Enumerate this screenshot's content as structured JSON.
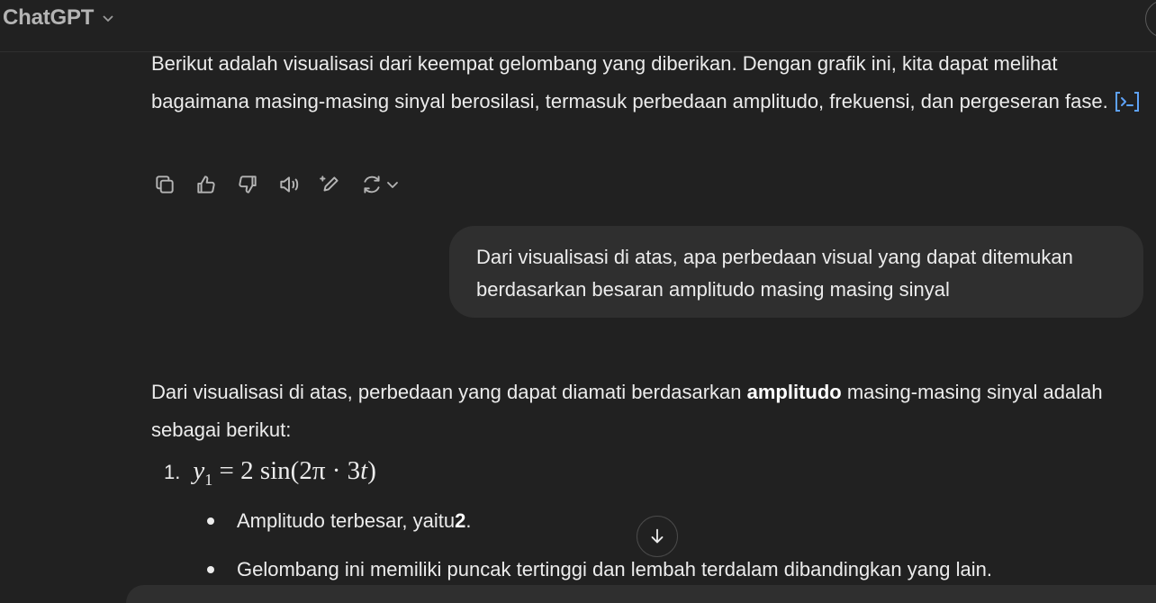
{
  "header": {
    "app_name": "ChatGPT"
  },
  "messages": {
    "assistant_intro": {
      "text": "Berikut adalah visualisasi dari keempat gelombang yang diberikan. Dengan grafik ini, kita dapat melihat bagaimana masing-masing sinyal berosilasi, termasuk perbedaan amplitudo, frekuensi, dan pergeseran fase."
    },
    "user_question": {
      "text": "Dari visualisasi di atas, apa perbedaan visual yang dapat ditemukan berdasarkan besaran amplitudo masing masing sinyal"
    },
    "assistant_answer": {
      "lead_before": "Dari visualisasi di atas, perbedaan yang dapat diamati berdasarkan ",
      "lead_bold": "amplitudo",
      "lead_after": " masing-masing sinyal adalah sebagai berikut:",
      "list": [
        {
          "number": "1.",
          "formula_var": "y",
          "formula_sub": "1",
          "formula_rest": " = 2 sin(2π · 3",
          "formula_t": "t",
          "formula_close": ")",
          "bullets": [
            {
              "before": "Amplitudo terbesar, yaitu ",
              "bold": "2",
              "after": "."
            },
            {
              "before": "Gelombang ini memiliki puncak tertinggi dan lembah terdalam dibandingkan yang lain.",
              "bold": "",
              "after": ""
            }
          ]
        }
      ]
    }
  },
  "icons": {
    "code_badge": "code-interpreter-icon",
    "actions": [
      "copy-icon",
      "thumbs-up-icon",
      "thumbs-down-icon",
      "read-aloud-icon",
      "edit-sparkle-icon",
      "regenerate-icon"
    ],
    "scroll": "arrow-down-icon"
  },
  "colors": {
    "background": "#212121",
    "bubble": "#2f2f2f",
    "text": "#ececec",
    "muted": "#b4b4b4",
    "link_blue": "#5ea2f7"
  }
}
